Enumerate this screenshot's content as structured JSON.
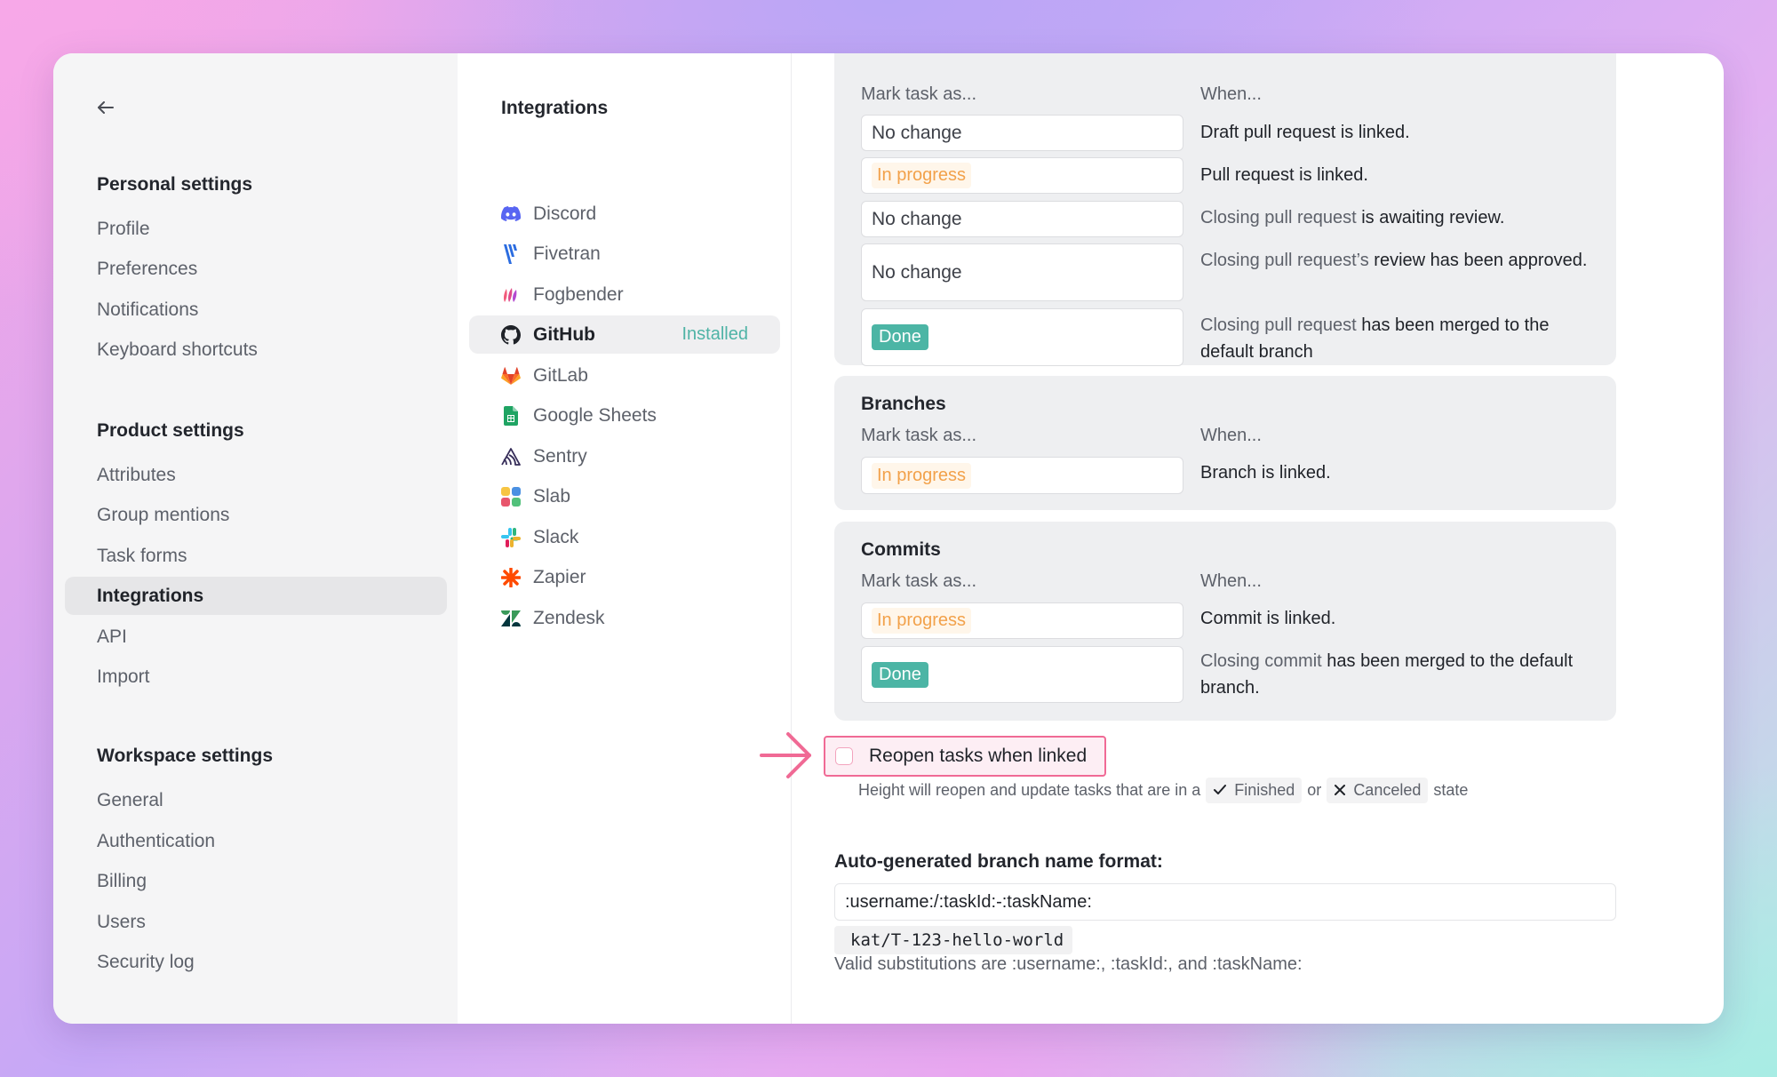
{
  "sidebar": {
    "personal_title": "Personal settings",
    "personal_items": [
      "Profile",
      "Preferences",
      "Notifications",
      "Keyboard shortcuts"
    ],
    "product_title": "Product settings",
    "product_items": [
      "Attributes",
      "Group mentions",
      "Task forms",
      "Integrations",
      "API",
      "Import"
    ],
    "workspace_title": "Workspace settings",
    "workspace_items": [
      "General",
      "Authentication",
      "Billing",
      "Users",
      "Security log"
    ],
    "active_item": "Integrations"
  },
  "integrations": {
    "title": "Integrations",
    "items": [
      {
        "name": "Discord",
        "icon": "discord-icon"
      },
      {
        "name": "Fivetran",
        "icon": "fivetran-icon"
      },
      {
        "name": "Fogbender",
        "icon": "fogbender-icon"
      },
      {
        "name": "GitHub",
        "icon": "github-icon",
        "status": "Installed"
      },
      {
        "name": "GitLab",
        "icon": "gitlab-icon"
      },
      {
        "name": "Google Sheets",
        "icon": "google-sheets-icon"
      },
      {
        "name": "Sentry",
        "icon": "sentry-icon"
      },
      {
        "name": "Slab",
        "icon": "slab-icon"
      },
      {
        "name": "Slack",
        "icon": "slack-icon"
      },
      {
        "name": "Zapier",
        "icon": "zapier-icon"
      },
      {
        "name": "Zendesk",
        "icon": "zendesk-icon"
      }
    ],
    "active": "GitHub"
  },
  "pull_requests": {
    "mark_header": "Mark task as...",
    "when_header": "When...",
    "rows": [
      {
        "status": "No change",
        "when_prefix": "",
        "when_text": "Draft pull request is linked."
      },
      {
        "status": "In progress",
        "when_prefix": "",
        "when_text": "Pull request is linked."
      },
      {
        "status": "No change",
        "when_prefix": "Closing pull request",
        "when_text": " is awaiting review."
      },
      {
        "status": "No change",
        "when_prefix": "Closing pull request’s",
        "when_text": " review has been approved."
      },
      {
        "status": "Done",
        "when_prefix": "Closing pull request",
        "when_text": " has been merged to the default branch"
      }
    ]
  },
  "branches": {
    "title": "Branches",
    "mark_header": "Mark task as...",
    "when_header": "When...",
    "rows": [
      {
        "status": "In progress",
        "when_text": "Branch is linked."
      }
    ]
  },
  "commits": {
    "title": "Commits",
    "mark_header": "Mark task as...",
    "when_header": "When...",
    "rows": [
      {
        "status": "In progress",
        "when_prefix": "",
        "when_text": "Commit is linked."
      },
      {
        "status": "Done",
        "when_prefix": "Closing commit",
        "when_text": " has been merged to the default branch."
      }
    ]
  },
  "reopen": {
    "label": "Reopen tasks when linked",
    "checked": false,
    "helper_prefix": "Height will reopen and update tasks that are in a",
    "finished": "Finished",
    "or": "or",
    "canceled": "Canceled",
    "helper_suffix": "state"
  },
  "branch_format": {
    "label": "Auto-generated branch name format:",
    "value": ":username:/:taskId:-:taskName:",
    "example": "kat/T-123-hello-world",
    "hint": "Valid substitutions are :username:, :taskId:, and :taskName:"
  },
  "colors": {
    "accent_done": "#4cb5a5",
    "in_progress": "#f2a14a",
    "installed": "#4fb3a6",
    "highlight": "#f06a95"
  }
}
